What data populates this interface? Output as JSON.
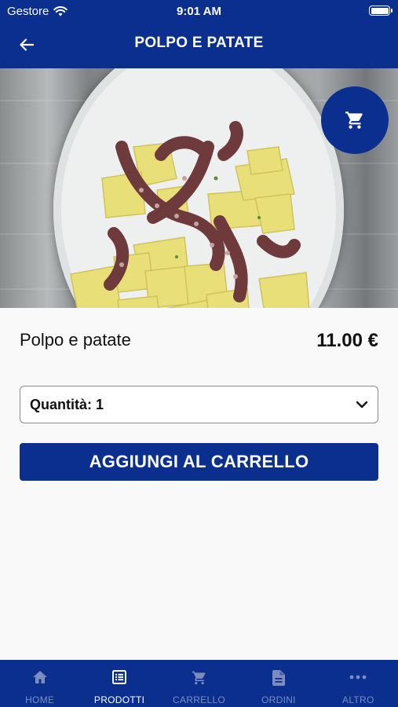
{
  "status": {
    "carrier": "Gestore",
    "time": "9:01 AM"
  },
  "header": {
    "title": "POLPO E PATATE"
  },
  "product": {
    "name": "Polpo e patate",
    "price": "11.00 €"
  },
  "quantity": {
    "label": "Quantità: 1"
  },
  "actions": {
    "add_to_cart": "AGGIUNGI AL CARRELLO"
  },
  "tabs": [
    {
      "label": "HOME",
      "icon": "home-icon",
      "active": false
    },
    {
      "label": "PRODOTTI",
      "icon": "list-icon",
      "active": true
    },
    {
      "label": "CARRELLO",
      "icon": "cart-icon",
      "active": false
    },
    {
      "label": "ORDINI",
      "icon": "document-icon",
      "active": false
    },
    {
      "label": "ALTRO",
      "icon": "more-icon",
      "active": false
    }
  ],
  "colors": {
    "brand": "#0a2f8f",
    "tab_inactive": "#7c8cbf",
    "background": "#f9f9f9"
  }
}
